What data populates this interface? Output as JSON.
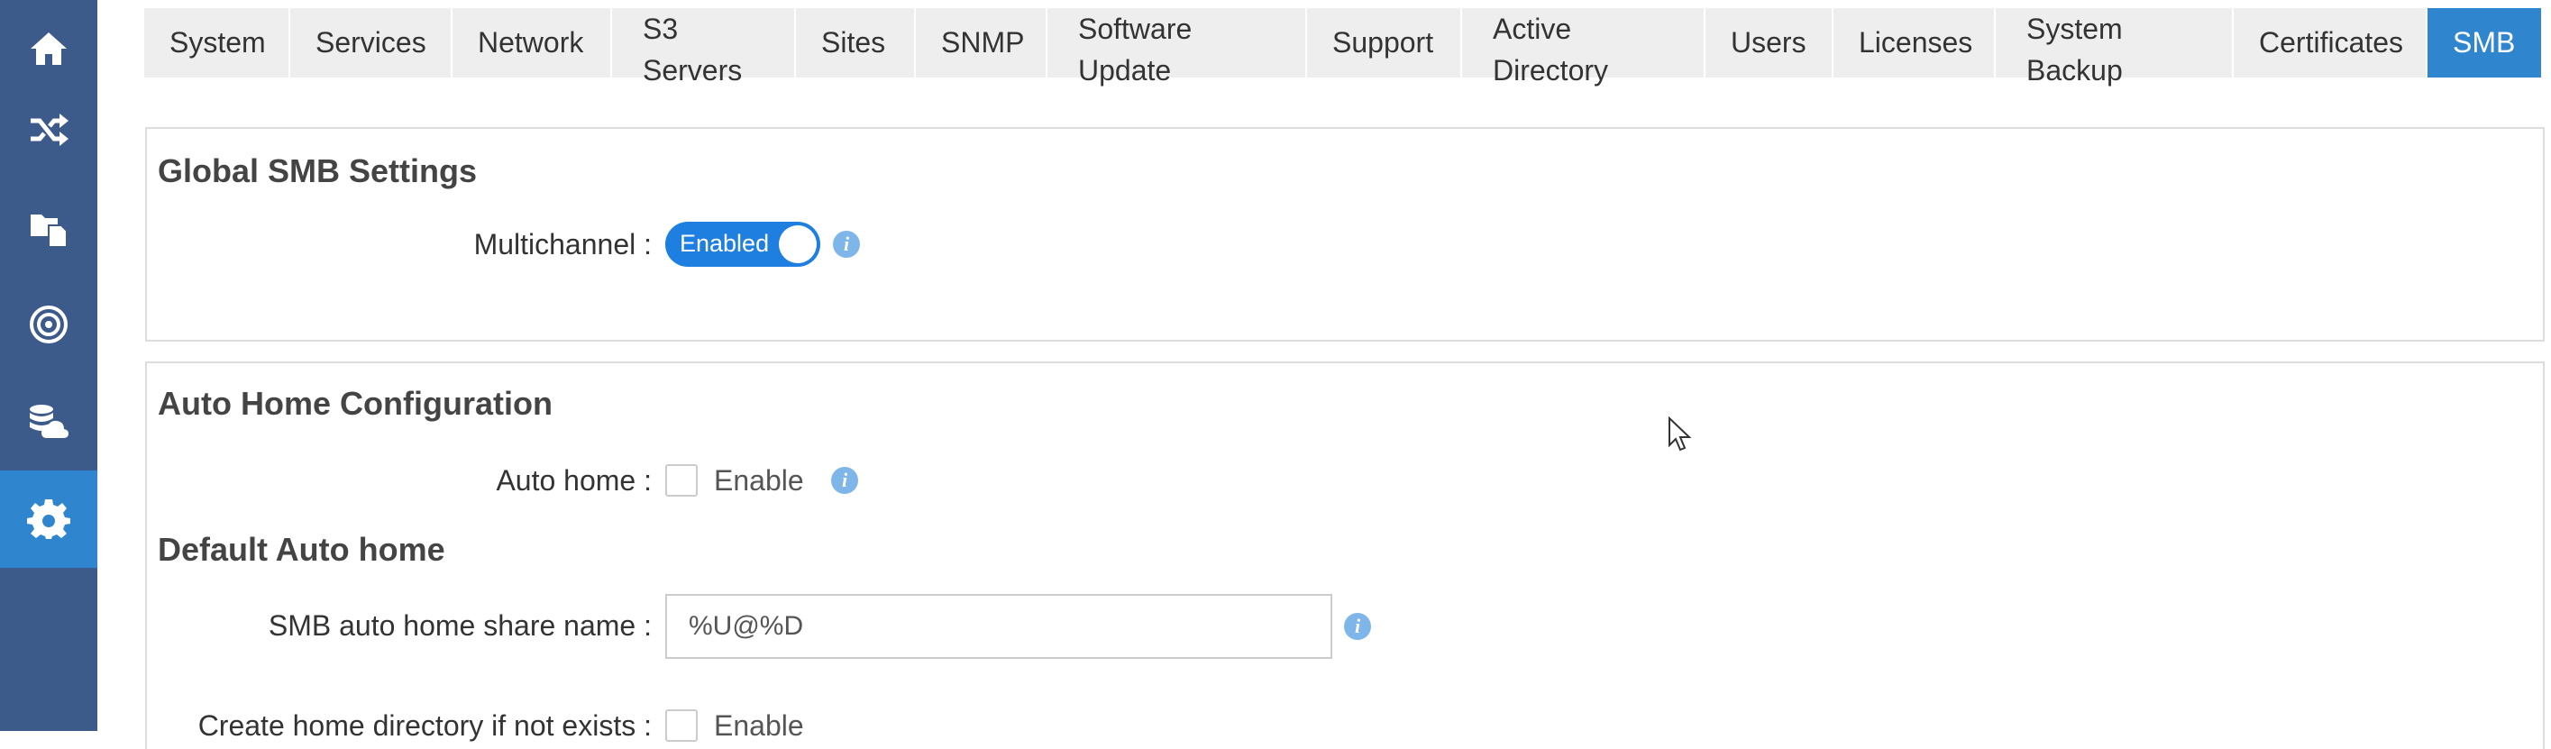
{
  "sidebar": {
    "items": [
      {
        "icon": "home-icon"
      },
      {
        "icon": "shuffle-icon"
      },
      {
        "icon": "files-icon"
      },
      {
        "icon": "target-icon"
      },
      {
        "icon": "database-cloud-icon"
      },
      {
        "icon": "gear-icon",
        "active": true
      }
    ]
  },
  "tabs": [
    {
      "label": "System"
    },
    {
      "label": "Services"
    },
    {
      "label": "Network"
    },
    {
      "label": "S3 Servers"
    },
    {
      "label": "Sites"
    },
    {
      "label": "SNMP"
    },
    {
      "label": "Software Update"
    },
    {
      "label": "Support"
    },
    {
      "label": "Active Directory"
    },
    {
      "label": "Users"
    },
    {
      "label": "Licenses"
    },
    {
      "label": "System Backup"
    },
    {
      "label": "Certificates"
    },
    {
      "label": "SMB",
      "active": true
    }
  ],
  "global_smb": {
    "title": "Global SMB Settings",
    "multichannel_label": "Multichannel :",
    "multichannel_value": "Enabled"
  },
  "auto_home": {
    "title": "Auto Home Configuration",
    "auto_home_label": "Auto home :",
    "auto_home_checkbox_label": "Enable",
    "default_title": "Default Auto home",
    "share_name_label": "SMB auto home share name :",
    "share_name_value": "%U@%D",
    "create_dir_label": "Create home directory if not exists :",
    "create_dir_checkbox_label": "Enable"
  },
  "colors": {
    "sidebar": "#3c5a8a",
    "accent": "#2f86cf",
    "toggle": "#1f7fe0"
  }
}
